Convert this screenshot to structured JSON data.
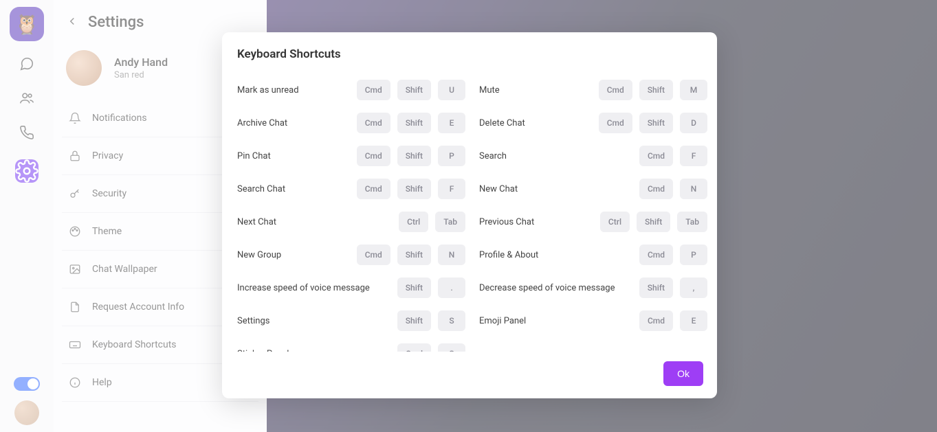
{
  "header": {
    "title": "Settings"
  },
  "profile": {
    "name": "Andy Hand",
    "status": "San red"
  },
  "menu": {
    "items": [
      {
        "label": "Notifications",
        "icon": "bell"
      },
      {
        "label": "Privacy",
        "icon": "lock"
      },
      {
        "label": "Security",
        "icon": "key"
      },
      {
        "label": "Theme",
        "icon": "paint"
      },
      {
        "label": "Chat Wallpaper",
        "icon": "image"
      },
      {
        "label": "Request Account Info",
        "icon": "doc"
      },
      {
        "label": "Keyboard Shortcuts",
        "icon": "keyboard"
      },
      {
        "label": "Help",
        "icon": "info"
      }
    ]
  },
  "modal": {
    "title": "Keyboard Shortcuts",
    "ok": "Ok",
    "shortcuts": [
      {
        "label": "Mark as unread",
        "keys": [
          "Cmd",
          "Shift",
          "U"
        ]
      },
      {
        "label": "Mute",
        "keys": [
          "Cmd",
          "Shift",
          "M"
        ]
      },
      {
        "label": "Archive Chat",
        "keys": [
          "Cmd",
          "Shift",
          "E"
        ]
      },
      {
        "label": "Delete Chat",
        "keys": [
          "Cmd",
          "Shift",
          "D"
        ]
      },
      {
        "label": "Pin Chat",
        "keys": [
          "Cmd",
          "Shift",
          "P"
        ]
      },
      {
        "label": "Search",
        "keys": [
          "Cmd",
          "F"
        ]
      },
      {
        "label": "Search Chat",
        "keys": [
          "Cmd",
          "Shift",
          "F"
        ]
      },
      {
        "label": "New Chat",
        "keys": [
          "Cmd",
          "N"
        ]
      },
      {
        "label": "Next Chat",
        "keys": [
          "Ctrl",
          "Tab"
        ]
      },
      {
        "label": "Previous Chat",
        "keys": [
          "Ctrl",
          "Shift",
          "Tab"
        ]
      },
      {
        "label": "New Group",
        "keys": [
          "Cmd",
          "Shift",
          "N"
        ]
      },
      {
        "label": "Profile & About",
        "keys": [
          "Cmd",
          "P"
        ]
      },
      {
        "label": "Increase speed of voice message",
        "keys": [
          "Shift",
          "."
        ]
      },
      {
        "label": "Decrease speed of voice message",
        "keys": [
          "Shift",
          ","
        ]
      },
      {
        "label": "Settings",
        "keys": [
          "Shift",
          "S"
        ]
      },
      {
        "label": "Emoji Panel",
        "keys": [
          "Cmd",
          "E"
        ]
      },
      {
        "label": "Sticker Panel",
        "keys": [
          "Cmd",
          "S"
        ]
      }
    ]
  }
}
